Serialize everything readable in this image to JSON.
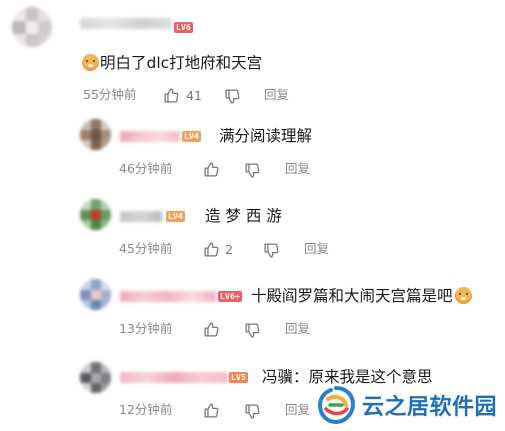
{
  "comments": [
    {
      "text": "明白了dlc打地府和天宫",
      "time": "55分钟前",
      "likes": "41",
      "reply_label": "回复",
      "level_badge": "LV6",
      "level_color": "#f05f5f",
      "has_emoji": true
    },
    {
      "text": "满分阅读理解",
      "time": "46分钟前",
      "likes": "",
      "reply_label": "回复",
      "level_badge": "LV4",
      "level_color": "#f6a15b"
    },
    {
      "text": "造 梦 西 游",
      "time": "45分钟前",
      "likes": "2",
      "reply_label": "回复",
      "level_badge": "LV4",
      "level_color": "#f6a15b"
    },
    {
      "text": "十殿阎罗篇和大闹天宫篇是吧",
      "time": "13分钟前",
      "likes": "",
      "reply_label": "回复",
      "level_badge": "LV6+",
      "level_color": "#f05f5f"
    },
    {
      "text": "冯骥：原来我是这个意思",
      "time": "12分钟前",
      "likes": "",
      "reply_label": "回复",
      "level_badge": "LV5",
      "level_color": "#f6864a"
    }
  ],
  "icons": {
    "like": "thumbs-up-icon",
    "dislike": "thumbs-down-icon",
    "emoji": "doge-emoji-icon"
  },
  "watermark": {
    "text": "云之居软件园"
  }
}
